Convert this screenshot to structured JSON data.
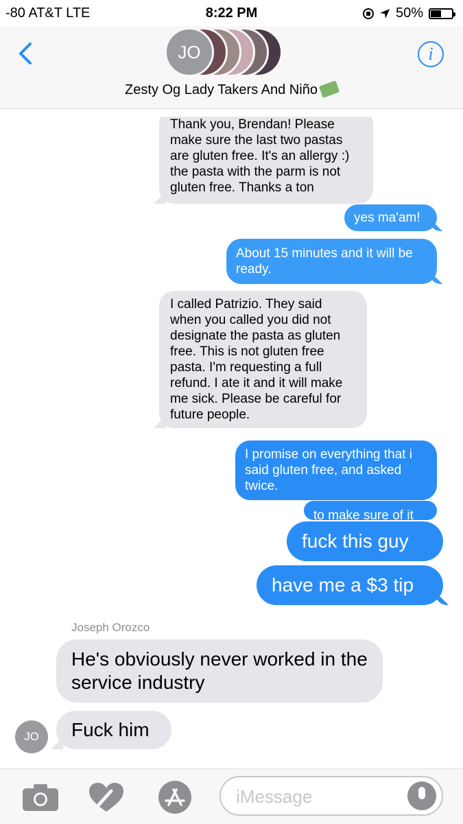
{
  "status": {
    "carrier": "-80 AT&T   LTE",
    "time": "8:22 PM",
    "battery": "50%",
    "battery_level": 0.5
  },
  "header": {
    "group_name": "Zesty Og Lady Takers And Niño",
    "avatar_initials": "JO"
  },
  "messages": [
    {
      "text": "Thank you, Brendan! Please make sure the last two pastas are gluten free. It's an allergy :) the pasta with the parm is not gluten free. Thanks a ton"
    },
    {
      "text": "yes ma'am!"
    },
    {
      "text": "About 15 minutes and it will be ready."
    },
    {
      "text": "I called Patrizio. They said when you called you did not designate the pasta as gluten free. This is not gluten free pasta. I'm requesting a full refund. I ate it and it will make me sick. Please be careful for future people."
    },
    {
      "text": "I promise on everything that i said gluten free, and asked twice."
    },
    {
      "text": "to make sure of it"
    },
    {
      "text": "fuck this guy"
    },
    {
      "text": "have me a $3 tip"
    },
    {
      "text": "He's obviously never worked in the service industry"
    },
    {
      "text": "Fuck him"
    }
  ],
  "sender_name": "Joseph Orozco",
  "sender_initials": "JO",
  "input": {
    "placeholder": "iMessage"
  },
  "colors": {
    "sent": "#2a8df5",
    "received": "#e5e5ea",
    "accent": "#2a8df5"
  }
}
